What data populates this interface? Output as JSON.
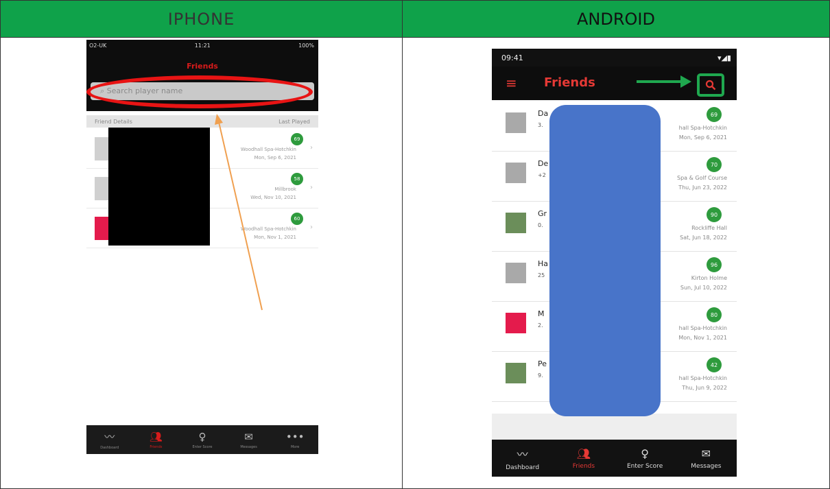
{
  "headers": {
    "iphone": "IPHONE",
    "android": "ANDROID"
  },
  "iphone": {
    "status": {
      "carrier": "O2-UK",
      "time": "11:21",
      "battery": "100%"
    },
    "title": "Friends",
    "search_placeholder": "Search player name",
    "list_header_left": "Friend Details",
    "list_header_right": "Last Played",
    "rows": [
      {
        "score": "69",
        "course": "Woodhall Spa-Hotchkin",
        "date": "Mon, Sep 6, 2021"
      },
      {
        "score": "58",
        "course": "Millbrook",
        "date": "Wed, Nov 10, 2021"
      },
      {
        "score": "60",
        "course": "Woodhall Spa-Hotchkin",
        "date": "Mon, Nov 1, 2021"
      }
    ],
    "tabs": [
      {
        "label": "Dashboard",
        "icon": "chart-line-icon"
      },
      {
        "label": "Friends",
        "icon": "friends-icon"
      },
      {
        "label": "Enter Score",
        "icon": "golf-pin-icon"
      },
      {
        "label": "Messages",
        "icon": "mail-icon"
      },
      {
        "label": "More",
        "icon": "more-dots-icon"
      }
    ]
  },
  "android": {
    "status": {
      "time": "09:41"
    },
    "title": "Friends",
    "rows": [
      {
        "name": "Da",
        "sub": "3.",
        "score": "69",
        "course": "hall Spa-Hotchkin",
        "date": "Mon, Sep 6, 2021"
      },
      {
        "name": "De",
        "sub": "+2",
        "score": "70",
        "course": "Spa & Golf Course",
        "date": "Thu, Jun 23, 2022"
      },
      {
        "name": "Gr",
        "sub": "0.",
        "score": "90",
        "course": "Rockliffe Hall",
        "date": "Sat, Jun 18, 2022"
      },
      {
        "name": "Ha",
        "sub": "25",
        "score": "96",
        "course": "Kirton Holme",
        "date": "Sun, Jul 10, 2022"
      },
      {
        "name": "M",
        "sub": "2.",
        "score": "80",
        "course": "hall Spa-Hotchkin",
        "date": "Mon, Nov 1, 2021"
      },
      {
        "name": "Pe",
        "sub": "9.",
        "score": "42",
        "course": "hall Spa-Hotchkin",
        "date": "Thu, Jun 9, 2022"
      }
    ],
    "tabs": [
      {
        "label": "Dashboard",
        "icon": "chart-line-icon"
      },
      {
        "label": "Friends",
        "icon": "friends-icon"
      },
      {
        "label": "Enter Score",
        "icon": "golf-pin-icon"
      },
      {
        "label": "Messages",
        "icon": "mail-icon"
      }
    ]
  },
  "colors": {
    "header_green": "#0fa24a",
    "app_red": "#e53935",
    "score_green": "#2e9b3d",
    "highlight_red": "#e81414",
    "highlight_green": "#1fa84f",
    "redaction_blue": "#4874c9",
    "arrow_orange": "#f0a050"
  }
}
